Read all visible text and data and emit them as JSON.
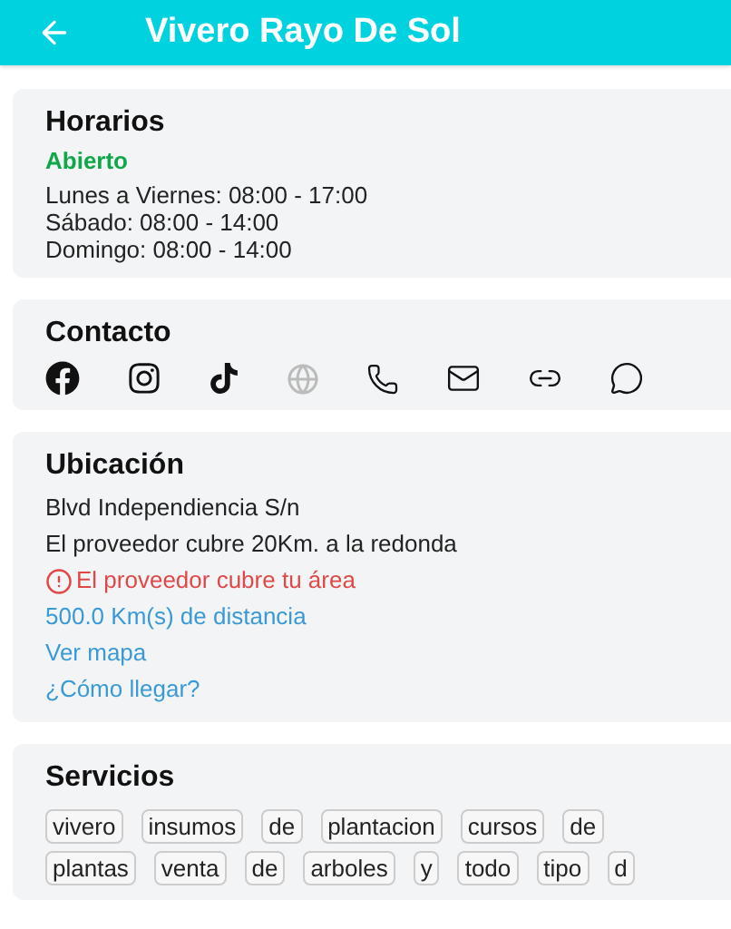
{
  "app_bar": {
    "title": "Vivero Rayo De Sol"
  },
  "horarios": {
    "title": "Horarios",
    "status": "Abierto",
    "open": true,
    "lines": [
      "Lunes a Viernes: 08:00 - 17:00",
      "Sábado: 08:00 - 14:00",
      "Domingo: 08:00 - 14:00"
    ]
  },
  "contacto": {
    "title": "Contacto",
    "icons": [
      {
        "kind": "facebook",
        "disabled": false
      },
      {
        "kind": "instagram",
        "disabled": false
      },
      {
        "kind": "tiktok",
        "disabled": false
      },
      {
        "kind": "web",
        "disabled": true
      },
      {
        "kind": "phone",
        "disabled": false
      },
      {
        "kind": "mail",
        "disabled": false
      },
      {
        "kind": "link",
        "disabled": false
      },
      {
        "kind": "chat",
        "disabled": false
      }
    ]
  },
  "ubicacion": {
    "title": "Ubicación",
    "address": "Blvd Independiencia S/n",
    "coverage": "El proveedor cubre 20Km. a la redonda",
    "alert": "El proveedor cubre tu área",
    "distance": "500.0 Km(s) de distancia",
    "links": [
      "Ver mapa",
      "¿Cómo llegar?"
    ]
  },
  "servicios": {
    "title": "Servicios",
    "tag_rows": [
      [
        "vivero",
        "insumos",
        "de",
        "plantacion",
        "cursos",
        "de"
      ],
      [
        "plantas",
        "venta",
        "de",
        "arboles",
        "y",
        "todo",
        "tipo",
        "d"
      ]
    ]
  }
}
